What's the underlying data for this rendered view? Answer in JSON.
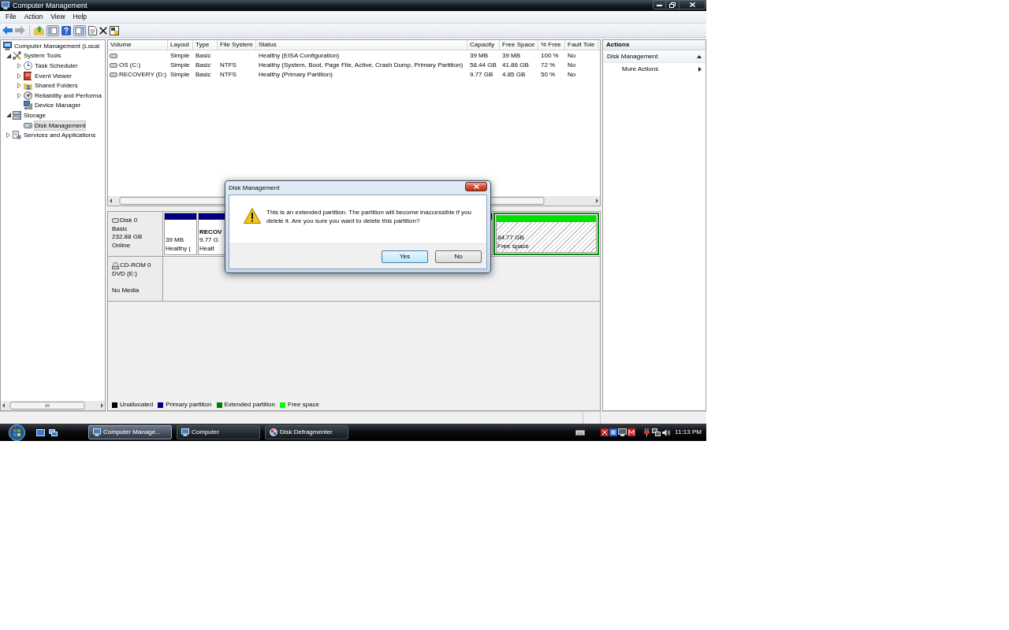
{
  "window": {
    "title": "Computer Management"
  },
  "menu": [
    "File",
    "Action",
    "View",
    "Help"
  ],
  "toolbar": [
    {
      "kind": "back",
      "disabled": false
    },
    {
      "kind": "forward",
      "disabled": true
    },
    {
      "kind": "separator"
    },
    {
      "kind": "up"
    },
    {
      "kind": "tree",
      "pressed": true
    },
    {
      "kind": "help"
    },
    {
      "kind": "actions",
      "pressed": true
    },
    {
      "kind": "export"
    },
    {
      "kind": "delete"
    },
    {
      "kind": "properties"
    }
  ],
  "tree": {
    "items": [
      {
        "kind": "computer",
        "label": "Computer Management (Local",
        "selected": false,
        "children": [
          {
            "kind": "tools",
            "label": "System Tools",
            "expanded": true,
            "selected": false,
            "children": [
              {
                "kind": "scheduler",
                "label": "Task Scheduler",
                "expanded": false,
                "selected": false
              },
              {
                "kind": "events",
                "label": "Event Viewer",
                "expanded": false,
                "selected": false
              },
              {
                "kind": "shares",
                "label": "Shared Folders",
                "expanded": false,
                "selected": false
              },
              {
                "kind": "performance",
                "label": "Reliability and Performa",
                "expanded": false,
                "selected": false
              },
              {
                "kind": "devices",
                "label": "Device Manager",
                "selected": false
              }
            ]
          },
          {
            "kind": "storage",
            "label": "Storage",
            "expanded": true,
            "selected": false,
            "children": [
              {
                "kind": "disks",
                "label": "Disk Management",
                "selected": true
              }
            ]
          },
          {
            "kind": "services",
            "label": "Services and Applications",
            "expanded": false,
            "selected": false
          }
        ]
      }
    ]
  },
  "volume_list": {
    "columns": [
      "Volume",
      "Layout",
      "Type",
      "File System",
      "Status",
      "Capacity",
      "Free Space",
      "% Free",
      "Fault Tole"
    ],
    "rows": [
      {
        "layout": "Simple",
        "type": "Basic",
        "status": "Healthy (EISA Configuration)",
        "capacity": "39 MB",
        "free_space": "39 MB",
        "percent_free": "100 %",
        "fault_tolerance": "No"
      },
      {
        "volume": "OS (C:)",
        "layout": "Simple",
        "type": "Basic",
        "file_system": "NTFS",
        "status": "Healthy (System, Boot, Page File, Active, Crash Dump, Primary Partition)",
        "capacity": "58.44 GB",
        "free_space": "41.86 GB",
        "percent_free": "72 %",
        "fault_tolerance": "No"
      },
      {
        "volume": "RECOVERY (D:)",
        "layout": "Simple",
        "type": "Basic",
        "file_system": "NTFS",
        "status": "Healthy (Primary Partition)",
        "capacity": "9.77 GB",
        "free_space": "4.85 GB",
        "percent_free": "50 %",
        "fault_tolerance": "No"
      }
    ]
  },
  "disks": [
    {
      "kind": "disk",
      "name": "Disk 0",
      "type": "Basic",
      "size": "232.88 GB",
      "status": "Online",
      "partitions": [
        {
          "kind": "primary",
          "size": "39 MB",
          "status": "Healthy ("
        },
        {
          "kind": "primary",
          "label": "RECOV",
          "size": "9.77 G",
          "status": "Healt"
        },
        {
          "kind": "extended",
          "partitions": [
            {
              "kind": "free",
              "size": "84.77 GB",
              "status": "Free space"
            }
          ]
        }
      ]
    },
    {
      "kind": "cdrom",
      "name": "CD-ROM 0",
      "type": "DVD (E:)",
      "status": "No Media"
    }
  ],
  "legend": [
    {
      "label": "Unallocated",
      "color": "#000000"
    },
    {
      "label": "Primary partition",
      "color": "#000080"
    },
    {
      "label": "Extended partition",
      "color": "#008000"
    },
    {
      "label": "Free space",
      "color": "#00ff00"
    }
  ],
  "actions": {
    "title": "Actions",
    "sections": [
      {
        "label": "Disk Management",
        "expanded": true,
        "items": [
          {
            "label": "More Actions",
            "submenu": true
          }
        ]
      }
    ]
  },
  "dialog": {
    "title": "Disk Management",
    "message": "This is an extended partition. The partition will become inaccessible if you delete it. Are you sure you want to delete this partition?",
    "buttons": [
      {
        "label": "Yes",
        "default": true
      },
      {
        "label": "No",
        "default": false
      }
    ]
  },
  "taskbar": {
    "tasks": [
      {
        "kind": "management",
        "label": "Computer Manage...",
        "selected": true
      },
      {
        "kind": "computer",
        "label": "Computer",
        "selected": false
      },
      {
        "kind": "defragmenter",
        "label": "Disk Defragmenter",
        "selected": false
      }
    ],
    "clock": "11:13 PM"
  }
}
